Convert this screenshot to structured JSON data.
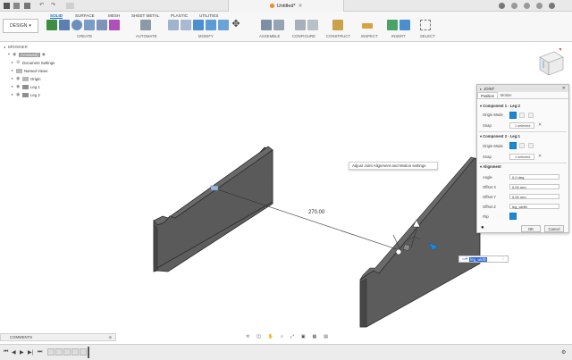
{
  "titlebar": {
    "document_title": "Untitled*"
  },
  "ribbon": {
    "workspace_label": "DESIGN",
    "tabs": [
      {
        "label": "SOLID",
        "active": true
      },
      {
        "label": "SURFACE",
        "active": false
      },
      {
        "label": "MESH",
        "active": false
      },
      {
        "label": "SHEET METAL",
        "active": false
      },
      {
        "label": "PLASTIC",
        "active": false
      },
      {
        "label": "UTILITIES",
        "active": false
      }
    ],
    "groups": {
      "create": "CREATE",
      "automate": "AUTOMATE",
      "modify": "MODIFY",
      "assemble": "ASSEMBLE",
      "configure": "CONFIGURE",
      "construct": "CONSTRUCT",
      "inspect": "INSPECT",
      "insert": "INSERT",
      "select": "SELECT"
    }
  },
  "browser": {
    "header": "BROWSER",
    "root": "(Unsaved)",
    "items": [
      {
        "label": "Document Settings"
      },
      {
        "label": "Named Views"
      },
      {
        "label": "Origin"
      },
      {
        "label": "Leg 1"
      },
      {
        "label": "Leg 2"
      }
    ]
  },
  "canvas": {
    "dimension": "270.00"
  },
  "tooltip": "Adjust Joint Alignment and Motion settings",
  "offset_input": {
    "value": "leg_width"
  },
  "joint_panel": {
    "title": "JOINT",
    "tabs": [
      "Position",
      "Motion"
    ],
    "component1": {
      "header": "Component 1 - Leg:2",
      "origin_mode_label": "Origin Mode",
      "snap_label": "Snap",
      "snap_value": "1 selected"
    },
    "component2": {
      "header": "Component 2 - Leg:1",
      "origin_mode_label": "Origin Mode",
      "snap_label": "Snap",
      "snap_value": "1 selected"
    },
    "alignment": {
      "header": "Alignment",
      "angle_label": "Angle",
      "angle_value": "0.0 deg",
      "offset_x_label": "Offset X",
      "offset_x_value": "0.00 mm",
      "offset_y_label": "Offset Y",
      "offset_y_value": "0.00 mm",
      "offset_z_label": "Offset Z",
      "offset_z_value": "leg_width",
      "flip_label": "Flip"
    },
    "ok_label": "OK",
    "cancel_label": "Cancel"
  },
  "comments": {
    "label": "COMMENTS"
  },
  "colors": {
    "accent": "#1b8ad6",
    "part_face": "#5e5e5e",
    "part_edge": "#2b2b2b"
  }
}
